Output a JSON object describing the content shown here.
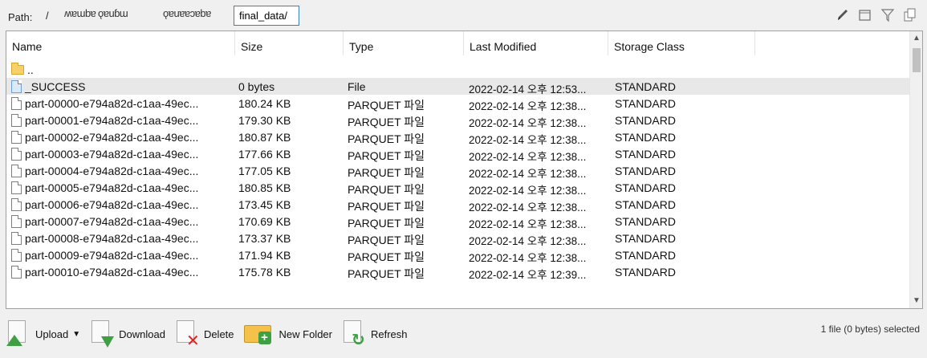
{
  "path": {
    "label": "Path:",
    "separator": "/",
    "segments": [
      "ʍɐɯbɐ",
      "ǫɐuɓɯ",
      "ǫɐuɐɐɔɐbɐ"
    ],
    "current": "final_data/"
  },
  "top_tools": [
    "pencil-icon",
    "window-icon",
    "filter-icon",
    "copy-icon"
  ],
  "columns": {
    "name": "Name",
    "size": "Size",
    "type": "Type",
    "modified": "Last Modified",
    "storage": "Storage Class"
  },
  "parent_row": {
    "name": ".."
  },
  "files": [
    {
      "name": "_SUCCESS",
      "size": "0 bytes",
      "type": "File",
      "modified": "2022-02-14 오후 12:53...",
      "storage": "STANDARD",
      "selected": true
    },
    {
      "name": "part-00000-e794a82d-c1aa-49ec...",
      "size": "180.24 KB",
      "type": "PARQUET 파일",
      "modified": "2022-02-14 오후 12:38...",
      "storage": "STANDARD"
    },
    {
      "name": "part-00001-e794a82d-c1aa-49ec...",
      "size": "179.30 KB",
      "type": "PARQUET 파일",
      "modified": "2022-02-14 오후 12:38...",
      "storage": "STANDARD"
    },
    {
      "name": "part-00002-e794a82d-c1aa-49ec...",
      "size": "180.87 KB",
      "type": "PARQUET 파일",
      "modified": "2022-02-14 오후 12:38...",
      "storage": "STANDARD"
    },
    {
      "name": "part-00003-e794a82d-c1aa-49ec...",
      "size": "177.66 KB",
      "type": "PARQUET 파일",
      "modified": "2022-02-14 오후 12:38...",
      "storage": "STANDARD"
    },
    {
      "name": "part-00004-e794a82d-c1aa-49ec...",
      "size": "177.05 KB",
      "type": "PARQUET 파일",
      "modified": "2022-02-14 오후 12:38...",
      "storage": "STANDARD"
    },
    {
      "name": "part-00005-e794a82d-c1aa-49ec...",
      "size": "180.85 KB",
      "type": "PARQUET 파일",
      "modified": "2022-02-14 오후 12:38...",
      "storage": "STANDARD"
    },
    {
      "name": "part-00006-e794a82d-c1aa-49ec...",
      "size": "173.45 KB",
      "type": "PARQUET 파일",
      "modified": "2022-02-14 오후 12:38...",
      "storage": "STANDARD"
    },
    {
      "name": "part-00007-e794a82d-c1aa-49ec...",
      "size": "170.69 KB",
      "type": "PARQUET 파일",
      "modified": "2022-02-14 오후 12:38...",
      "storage": "STANDARD"
    },
    {
      "name": "part-00008-e794a82d-c1aa-49ec...",
      "size": "173.37 KB",
      "type": "PARQUET 파일",
      "modified": "2022-02-14 오후 12:38...",
      "storage": "STANDARD"
    },
    {
      "name": "part-00009-e794a82d-c1aa-49ec...",
      "size": "171.94 KB",
      "type": "PARQUET 파일",
      "modified": "2022-02-14 오후 12:38...",
      "storage": "STANDARD"
    },
    {
      "name": "part-00010-e794a82d-c1aa-49ec...",
      "size": "175.78 KB",
      "type": "PARQUET 파일",
      "modified": "2022-02-14 오후 12:39...",
      "storage": "STANDARD"
    }
  ],
  "toolbar": {
    "upload": "Upload",
    "download": "Download",
    "delete": "Delete",
    "new_folder": "New Folder",
    "refresh": "Refresh"
  },
  "status": "1 file (0 bytes) selected",
  "colors": {
    "accent": "#3c7fb1",
    "selected_row": "#e8e8e8",
    "green": "#3ea043"
  }
}
